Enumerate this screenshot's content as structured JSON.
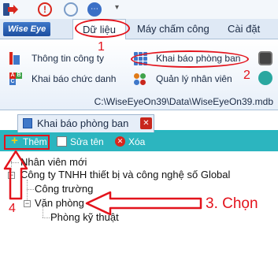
{
  "quick_access": {
    "info_glyph": "!",
    "chat_glyph": "⋯",
    "dropdown_glyph": "▾"
  },
  "ribbon": {
    "logo_text": "Wise Eye",
    "tabs": [
      {
        "label": "Dữ liệu",
        "active": true
      },
      {
        "label": "Máy chấm công",
        "active": false
      },
      {
        "label": "Cài đặt chấ",
        "active": false
      }
    ],
    "buttons": {
      "company_info": "Thông tin công ty",
      "position_declare": "Khai báo chức danh",
      "department_declare": "Khai báo phòng ban",
      "employee_manage": "Quản lý nhân viên"
    },
    "kbcd_letters": [
      "A",
      "B",
      "C"
    ],
    "path": "C:\\WiseEyeOn39\\Data\\WiseEyeOn39.mdb"
  },
  "document_tab": {
    "title": "Khai báo phòng ban",
    "close_glyph": "✕"
  },
  "toolbar": {
    "add_label": "Thêm",
    "add_glyph": "+",
    "rename_label": "Sửa tên",
    "delete_label": "Xóa",
    "delete_glyph": "✕"
  },
  "tree": {
    "new_employee": "Nhân viên mới",
    "company": "Công ty TNHH thiết bị và công nghệ số Global",
    "construction": "Công trường",
    "office": "Văn phòng",
    "technical": "Phòng kỹ thuật",
    "collapse_glyph": "−"
  },
  "annotations": {
    "step1": "1",
    "step2": "2",
    "step3": "3. Chọn",
    "step4": "4",
    "color": "#e3131c"
  },
  "colors": {
    "accent_teal": "#2cb5bf",
    "ribbon_blue": "#3f78c9"
  }
}
